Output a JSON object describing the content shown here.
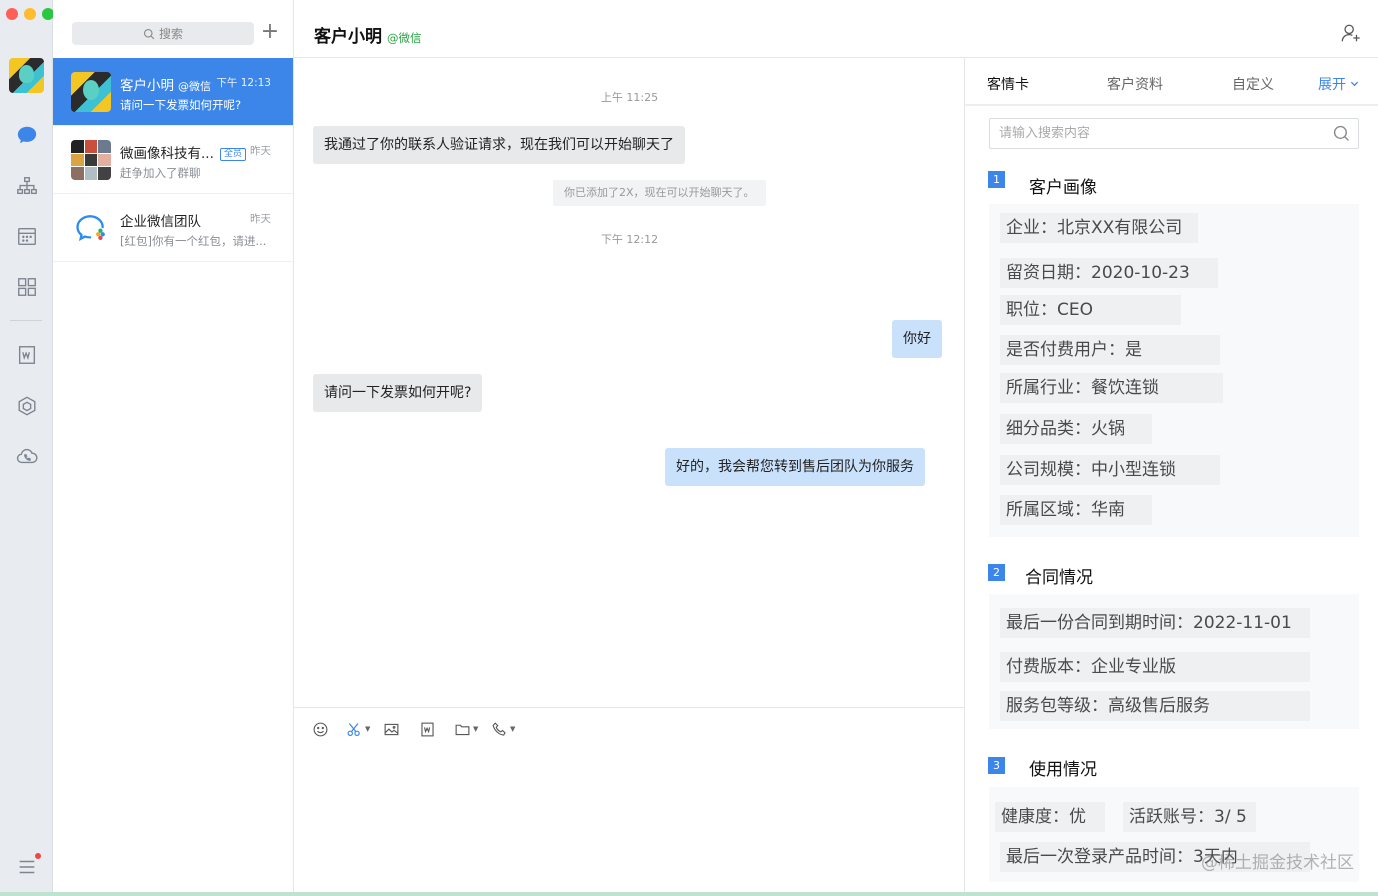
{
  "window": {
    "traffic": [
      "close",
      "minimize",
      "zoom"
    ]
  },
  "rail": {
    "items": [
      {
        "icon": "chat-bubble-icon"
      },
      {
        "icon": "org-chart-icon"
      },
      {
        "icon": "calendar-icon"
      },
      {
        "icon": "apps-grid-icon"
      },
      {
        "icon": "word-doc-icon"
      },
      {
        "icon": "cube-icon"
      },
      {
        "icon": "cloud-phone-icon"
      },
      {
        "icon": "menu-icon"
      }
    ]
  },
  "convlist": {
    "search_placeholder": "搜索",
    "add_label": "+",
    "items": [
      {
        "name": "客户小明",
        "tag": "@微信",
        "time": "下午 12:13",
        "preview": "请问一下发票如何开呢?"
      },
      {
        "name": "微画像科技有...",
        "badge": "全员",
        "time": "昨天",
        "preview": "赶争加入了群聊"
      },
      {
        "name": "企业微信团队",
        "time": "昨天",
        "preview": "[红包]你有一个红包，请进..."
      }
    ]
  },
  "chat": {
    "title": "客户小明",
    "title_tag": "@微信",
    "messages": [
      {
        "kind": "time",
        "text": "上午 11:25"
      },
      {
        "kind": "in",
        "text": "我通过了你的联系人验证请求，现在我们可以开始聊天了"
      },
      {
        "kind": "system",
        "text": "你已添加了2X，现在可以开始聊天了。"
      },
      {
        "kind": "time",
        "text": "下午 12:12"
      },
      {
        "kind": "out",
        "text": "你好"
      },
      {
        "kind": "in",
        "text": "请问一下发票如何开呢?"
      },
      {
        "kind": "out",
        "text": "好的，我会帮您转到售后团队为你服务"
      }
    ]
  },
  "composer": {
    "tools": [
      "emoji-icon",
      "scissors-icon",
      "image-icon",
      "word-doc-icon",
      "folder-icon",
      "phone-icon"
    ]
  },
  "panel": {
    "tabs": [
      {
        "label": "客情卡",
        "active": true
      },
      {
        "label": "客户资料"
      },
      {
        "label": "自定义"
      },
      {
        "label": "展开"
      }
    ],
    "search_placeholder": "请输入搜索内容",
    "sections": [
      {
        "num": "1",
        "title": "客户画像",
        "fields": [
          "企业：北京XX有限公司",
          "留资日期：2020-10-23",
          "职位：CEO",
          "是否付费用户：是",
          "所属行业：餐饮连锁",
          "细分品类：火锅",
          "公司规模：中小型连锁",
          "所属区域：华南"
        ]
      },
      {
        "num": "2",
        "title": "合同情况",
        "fields": [
          "最后一份合同到期时间：2022-11-01",
          "付费版本：企业专业版",
          "服务包等级：高级售后服务"
        ]
      },
      {
        "num": "3",
        "title": "使用情况",
        "fields": [
          "健康度：优",
          "活跃账号：3/ 5",
          "最后一次登录产品时间：3天内"
        ]
      }
    ]
  },
  "watermark": "@稀土掘金技术社区"
}
